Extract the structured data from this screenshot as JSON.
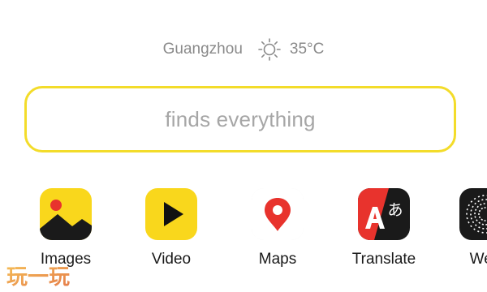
{
  "weather": {
    "city": "Guangzhou",
    "icon": "sun-icon",
    "temperature": "35°C"
  },
  "search": {
    "placeholder": "finds everything"
  },
  "services": [
    {
      "label": "Images",
      "icon": "images-icon",
      "color": "#f9d71c"
    },
    {
      "label": "Video",
      "icon": "play-icon",
      "color": "#f9d71c"
    },
    {
      "label": "Maps",
      "icon": "map-pin-icon",
      "color": "#e8332d"
    },
    {
      "label": "Translate",
      "icon": "translate-icon",
      "color": "#e8332d"
    },
    {
      "label": "Wea",
      "icon": "weather-app-icon",
      "color": "#1a1a1a"
    }
  ],
  "watermark": {
    "text": "玩一玩"
  },
  "colors": {
    "accent_yellow": "#f3dc2a",
    "text_grey": "#8a8a8a",
    "red": "#e8332d"
  }
}
